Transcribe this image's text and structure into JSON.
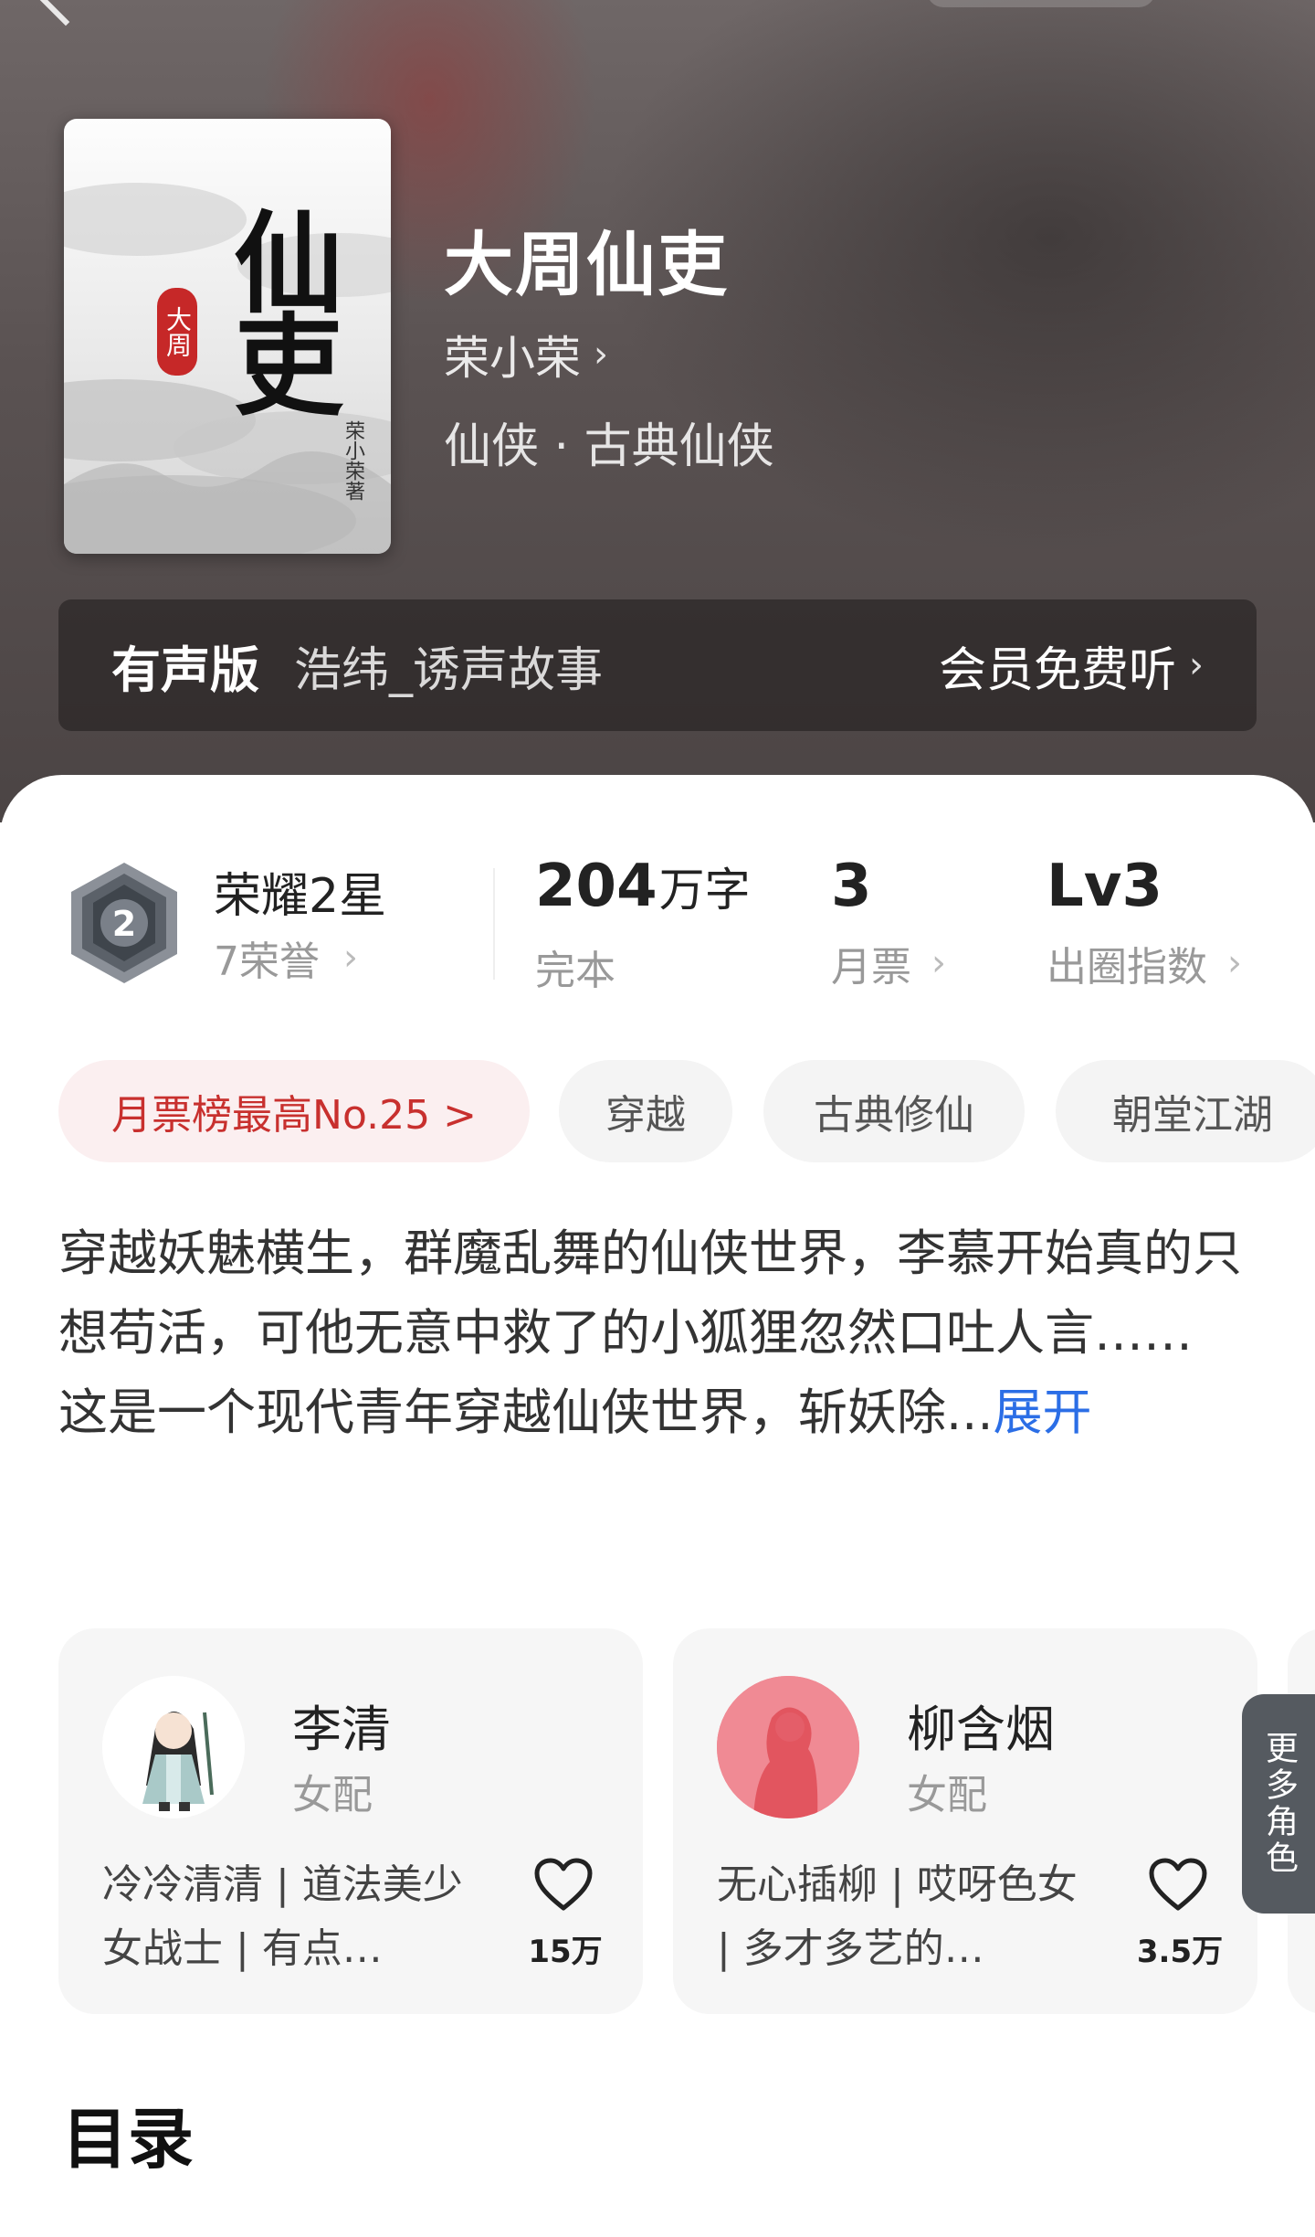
{
  "book": {
    "title": "大周仙吏",
    "author": "荣小荣",
    "genre": "仙侠 · 古典仙侠",
    "cover": {
      "title": "仙吏",
      "seal": "大周",
      "author": "荣小荣著"
    }
  },
  "audio": {
    "label": "有声版",
    "narrator": "浩纬_诱声故事",
    "cta": "会员免费听"
  },
  "stats": {
    "honor_title": "荣耀2星",
    "honor_sub": "7荣誉",
    "honor_level": "2",
    "word_count": "204",
    "word_unit": "万字",
    "status": "完本",
    "monthly_tickets": "3",
    "monthly_label": "月票",
    "influence_value": "Lv3",
    "influence_label": "出圈指数"
  },
  "tags": [
    "月票榜最高No.25 >",
    "穿越",
    "古典修仙",
    "朝堂江湖"
  ],
  "synopsis": {
    "line1": "穿越妖魅横生，群魔乱舞的仙侠世界，李慕开始真的只想苟活，可他无意中救了的小狐狸忽然口吐人言……",
    "line2": "这是一个现代青年穿越仙侠世界，斩妖除...",
    "expand": "展开"
  },
  "characters": [
    {
      "name": "李清",
      "role": "女配",
      "desc": "冷冷清清 | 道法美少女战士 | 有点…",
      "likes": "15万"
    },
    {
      "name": "柳含烟",
      "role": "女配",
      "desc": "无心插柳 | 哎呀色女 | 多才多艺的…",
      "likes": "3.5万"
    }
  ],
  "more_roles": "更多角色",
  "toc_title": "目录",
  "colors": {
    "accent_red": "#c8302e",
    "link_blue": "#2b6ee6",
    "hero_bg": "#5a5252"
  }
}
